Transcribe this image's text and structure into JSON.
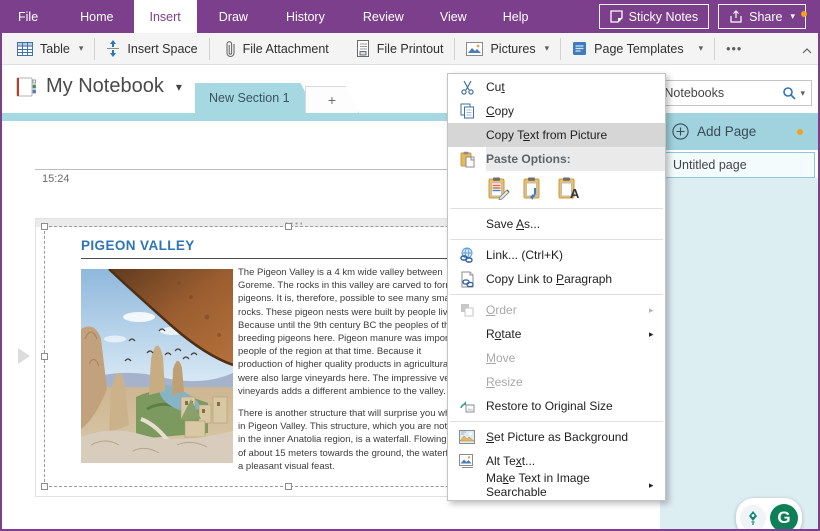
{
  "ribbon": {
    "tabs": [
      "File",
      "Home",
      "Insert",
      "Draw",
      "History",
      "Review",
      "View",
      "Help"
    ],
    "active_tab": "Insert",
    "sticky_notes_label": "Sticky Notes",
    "share_label": "Share",
    "share_caret": "▾"
  },
  "toolbar": {
    "table_label": "Table",
    "insert_space_label": "Insert Space",
    "file_attachment_label": "File Attachment",
    "file_printout_label": "File Printout",
    "pictures_label": "Pictures",
    "page_templates_label": "Page Templates",
    "more_label": "•••",
    "caret": "▾"
  },
  "notebook": {
    "title": "My Notebook",
    "title_caret": "▾",
    "section_tab": "New Section 1",
    "new_section_tab": "+"
  },
  "page": {
    "time": "15:24",
    "heading": "PIGEON VALLEY",
    "para1_lines": [
      "The Pigeon Valley is a 4 km wide valley between",
      "Goreme. The rocks in this valley are carved to form",
      "pigeons. It is, therefore, possible to see many small",
      "rocks. These pigeon nests were built by people living",
      "Because until the 9th century BC the peoples of the",
      "breeding pigeons here. Pigeon manure was impor",
      "people of the region at that time. Because it",
      "production of higher quality products in agricultural",
      "were also large vineyards here. The impressive vege",
      "vineyards adds a different ambience to the valley."
    ],
    "para2_lines": [
      "There is another structure that will surprise you wh",
      "in Pigeon Valley. This structure, which you are not us",
      "in the inner Anatolia region, is a waterfall. Flowing fro",
      "of about 15 meters towards the ground, the waterfa",
      "a pleasant visual feast."
    ]
  },
  "menu": {
    "paste_header": "Paste Options:",
    "paste_options": [
      "keep-source-formatting",
      "merge-formatting",
      "keep-text-only"
    ],
    "items": {
      "cut": {
        "pre": "Cu",
        "key": "t",
        "post": ""
      },
      "copy": {
        "pre": "",
        "key": "C",
        "post": "opy"
      },
      "copy_text": {
        "pre": "Copy T",
        "key": "e",
        "post": "xt from Picture"
      },
      "save_as": {
        "pre": "Save ",
        "key": "A",
        "post": "s..."
      },
      "link": {
        "pre": "Link...  (Ctrl+K)",
        "key": "",
        "post": ""
      },
      "copy_link": {
        "pre": "Copy Link to ",
        "key": "P",
        "post": "aragraph"
      },
      "order": {
        "pre": "",
        "key": "O",
        "post": "rder"
      },
      "rotate": {
        "pre": "R",
        "key": "o",
        "post": "tate"
      },
      "move": {
        "pre": "",
        "key": "M",
        "post": "ove"
      },
      "resize": {
        "pre": "",
        "key": "R",
        "post": "esize"
      },
      "restore": {
        "pre": "Restore to Original Size",
        "key": "",
        "post": ""
      },
      "set_bg": {
        "pre": "",
        "key": "S",
        "post": "et Picture as Background"
      },
      "alt_text": {
        "pre": "Alt Te",
        "key": "x",
        "post": "t..."
      },
      "make_searchable": {
        "pre": "Ma",
        "key": "k",
        "post": "e Text in Image Searchable"
      }
    },
    "submenu_arrow": "▸"
  },
  "sidebar": {
    "search_text": "All Notebooks",
    "search_caret": "▾",
    "add_page_label": "Add Page",
    "page_item": "Untitled page"
  },
  "grammarly": {
    "g_label": "G"
  },
  "colors": {
    "ribbon_purple": "#7c3f8c",
    "section_teal": "#a6d8e2",
    "sidebar_blue": "#ddeef3",
    "heading_blue": "#2e75b6",
    "menu_highlight": "#d6d6d6",
    "accent_orange": "#f2a21c",
    "grammarly_green": "#0e7f57"
  }
}
